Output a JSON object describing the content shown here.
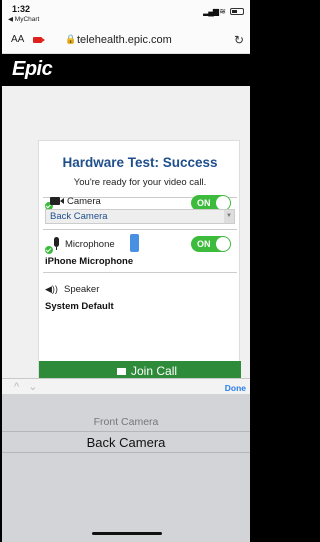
{
  "status_bar": {
    "time": "1:32",
    "back_app": "◀ MyChart",
    "signal": "▂▄▆ ≋"
  },
  "browser": {
    "text_size": "AA",
    "url": "telehealth.epic.com",
    "lock": "🔒",
    "reload": "↻"
  },
  "header": {
    "logo": "Epic"
  },
  "card": {
    "title": "Hardware Test: Success",
    "subtitle": "You're ready for your video call.",
    "camera": {
      "label": "Camera",
      "toggle": "ON",
      "selected_device": "Back Camera"
    },
    "microphone": {
      "label": "Microphone",
      "toggle": "ON",
      "device": "iPhone Microphone"
    },
    "speaker": {
      "label": "Speaker",
      "device": "System Default"
    },
    "join_label": "Join Call"
  },
  "keyboard_accessory": {
    "arrows": "^ ⌄",
    "done_label": "Done"
  },
  "picker": {
    "options": [
      "Front Camera",
      "Back Camera"
    ],
    "selected": "Back Camera"
  },
  "colors": {
    "title_blue": "#1f4f8b",
    "toggle_green": "#3dbb3d",
    "join_green": "#2e8b3a",
    "done_blue": "#2a7ee8"
  }
}
